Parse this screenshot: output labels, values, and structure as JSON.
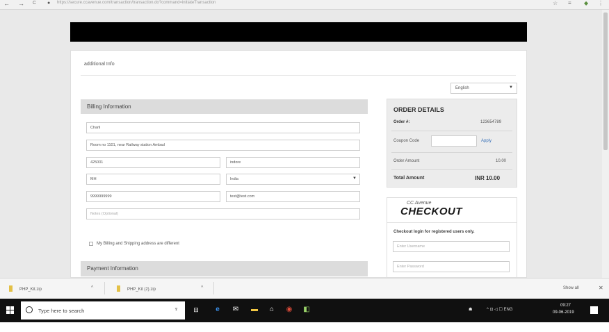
{
  "browser": {
    "back": "←",
    "forward": "→",
    "reload": "C",
    "url": "https://secure.ccavenue.com/transaction/transaction.do?command=initiateTransaction",
    "star": "☆",
    "menu": "≡"
  },
  "page": {
    "additional_info": "additional Info",
    "language": "English",
    "billing_header": "Billing Information",
    "billing": {
      "name": "Charli",
      "address": "Room no 1101, near Railway station Ambad",
      "zip": "425001",
      "city": "indore",
      "state": "MH",
      "country": "India",
      "phone": "9999999999",
      "email": "test@test.com",
      "notes_placeholder": "Notes (Optional)"
    },
    "shipping_checkbox_label": "My Billing and Shipping address are different",
    "payment_header": "Payment Information"
  },
  "order": {
    "title": "ORDER DETAILS",
    "order_label": "Order #:",
    "order_value": "123654789",
    "coupon_label": "Coupon Code",
    "apply": "Apply",
    "amount_label": "Order Amount",
    "amount_value": "10.00",
    "total_label": "Total Amount",
    "total_value": "INR 10.00"
  },
  "checkout": {
    "logo_small": "CC Avenue",
    "logo_big": "CHECKOUT",
    "login_text": "Checkout login for registered users only.",
    "username_placeholder": "Enter Username",
    "password_placeholder": "Enter Password"
  },
  "downloads": {
    "items": [
      {
        "name": "PHP_Kit.zip"
      },
      {
        "name": "PHP_Kit (2).zip"
      }
    ],
    "show_all": "Show all",
    "close": "✕"
  },
  "taskbar": {
    "search_placeholder": "Type here to search",
    "tray_text": "^ ⊡ ◁ ☐ ENG",
    "time": "09:27",
    "date": "09-06-2019"
  },
  "colors": {
    "banner": "#000000",
    "section_header": "#dcdcdc",
    "order_box": "#ececec",
    "apply_link": "#3b73b9",
    "taskbar": "#101010"
  }
}
